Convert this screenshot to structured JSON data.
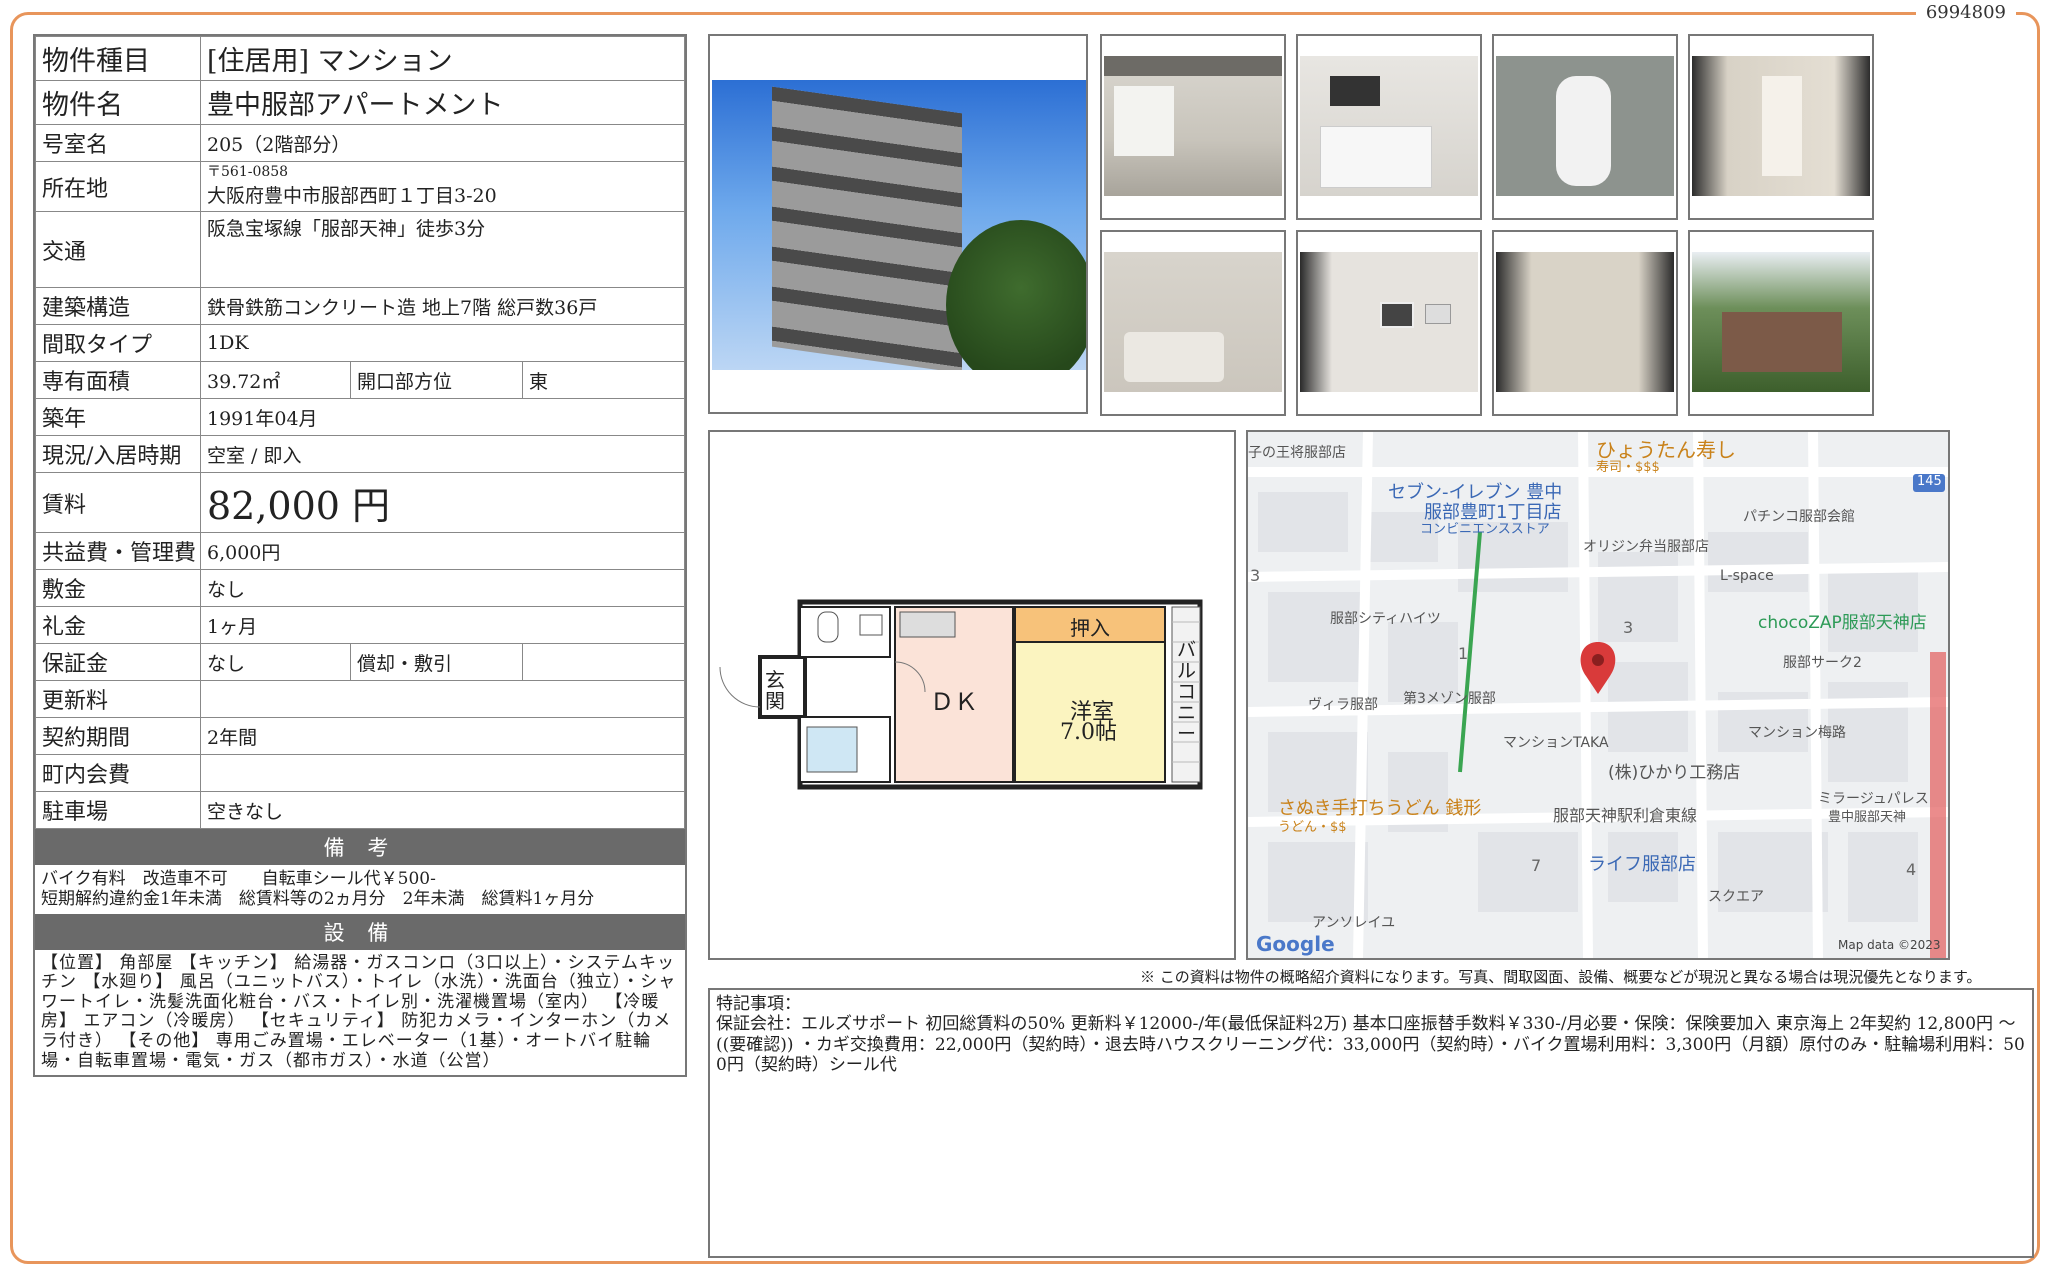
{
  "doc_id": "6994809",
  "property": {
    "type_label": "物件種目",
    "type_value": "[住居用]  マンション",
    "name_label": "物件名",
    "name_value": "豊中服部アパートメント",
    "room_label": "号室名",
    "room_value": "205（2階部分）",
    "address_label": "所在地",
    "postal": "〒561-0858",
    "address_value": "大阪府豊中市服部西町１丁目3-20",
    "access_label": "交通",
    "access_value": "阪急宝塚線「服部天神」徒歩3分",
    "structure_label": "建築構造",
    "structure_value": "鉄骨鉄筋コンクリート造 地上7階 総戸数36戸",
    "layout_label": "間取タイプ",
    "layout_value": "1DK",
    "area_label": "専有面積",
    "area_value": "39.72㎡",
    "orientation_label": "開口部方位",
    "orientation_value": "東",
    "built_label": "築年",
    "built_value": "1991年04月",
    "status_label": "現況/入居時期",
    "status_value": "空室 / 即入",
    "rent_label": "賃料",
    "rent_value": "82,000 円",
    "fee_label": "共益費・管理費",
    "fee_value": "6,000円",
    "deposit_label": "敷金",
    "deposit_value": "なし",
    "keymoney_label": "礼金",
    "keymoney_value": "1ヶ月",
    "guarantee_label": "保証金",
    "guarantee_value": "なし",
    "repay_label": "償却・敷引",
    "repay_value": "",
    "renewal_label": "更新料",
    "renewal_value": "",
    "contract_label": "契約期間",
    "contract_value": "2年間",
    "town_label": "町内会費",
    "town_value": "",
    "parking_label": "駐車場",
    "parking_value": "空きなし"
  },
  "remarks": {
    "heading": "備 考",
    "line1": "バイク有料　改造車不可　　自転車シール代￥500-",
    "line2": "短期解約違約金1年未満　総賃料等の2ヵ月分　2年未満　総賃料1ヶ月分"
  },
  "equipment": {
    "heading": "設 備",
    "text": "【位置】 角部屋 【キッチン】 給湯器・ガスコンロ（3口以上）・システムキッチン 【水廻り】 風呂（ユニットバス）・トイレ（水洗）・洗面台（独立）・シャワートイレ・洗髪洗面化粧台・バス・トイレ別・洗濯機置場（室内） 【冷暖房】 エアコン（冷暖房） 【セキュリティ】 防犯カメラ・インターホン（カメラ付き） 【その他】 専用ごみ置場・エレベーター（1基）・オートバイ駐輪場・自転車置場・電気・ガス（都市ガス）・水道（公営）"
  },
  "floorplan": {
    "entrance": "玄関",
    "dk": "ＤＫ",
    "closet": "押入",
    "room": "洋室",
    "room_size": "7.0帖",
    "balcony": "バルコニー"
  },
  "map": {
    "labels": {
      "a": "子の王将服部店",
      "b": "ひょうたん寿し",
      "b_sub": "寿司・$$$",
      "c": "セブン-イレブン 豊中",
      "c2": "服部豊町1丁目店",
      "c_sub": "コンビニエンスストア",
      "d": "パチンコ服部会館",
      "e": "オリジン弁当服部店",
      "f": "L-space",
      "g": "chocoZAP服部天神店",
      "h": "服部シティハイツ",
      "i": "服部サーク2",
      "j": "ヴィラ服部",
      "k": "第3メゾン服部",
      "l": "マンションTAKA",
      "m": "マンション梅路",
      "n": "(株)ひかり工務店",
      "o": "さぬき手打ちうどん 銭形",
      "o_sub": "うどん・$$",
      "p": "服部天神駅利倉東線",
      "q": "ミラージュパレス",
      "q2": "豊中服部天神",
      "r": "ライフ服部店",
      "s": "スクエア",
      "t": "アンソレイユ",
      "route": "145",
      "n3a": "3",
      "n3b": "3",
      "n1": "1",
      "n7": "7",
      "n4": "4",
      "google": "Google",
      "mapdata": "Map data ©2023"
    }
  },
  "disclaimer": "※ この資料は物件の概略紹介資料になります。写真、間取図面、設備、概要などが現況と異なる場合は現況優先となります。",
  "special": {
    "heading": "特記事項：",
    "body": "保証会社：エルズサポート 初回総賃料の50% 更新料￥12000-/年(最低保証料2万) 基本口座振替手数料￥330-/月必要・保険：保険要加入 東京海上 2年契約 12,800円 ～ ((要確認)) ・カギ交換費用：22,000円（契約時）・退去時ハウスクリーニング代：33,000円（契約時）・バイク置場利用料：3,300円（月額）原付のみ・駐輪場利用料：500円（契約時）シール代"
  },
  "colors": {
    "frame": "#e8955b",
    "header_bar": "#6a6a6a",
    "pin": "#d93a3a"
  }
}
